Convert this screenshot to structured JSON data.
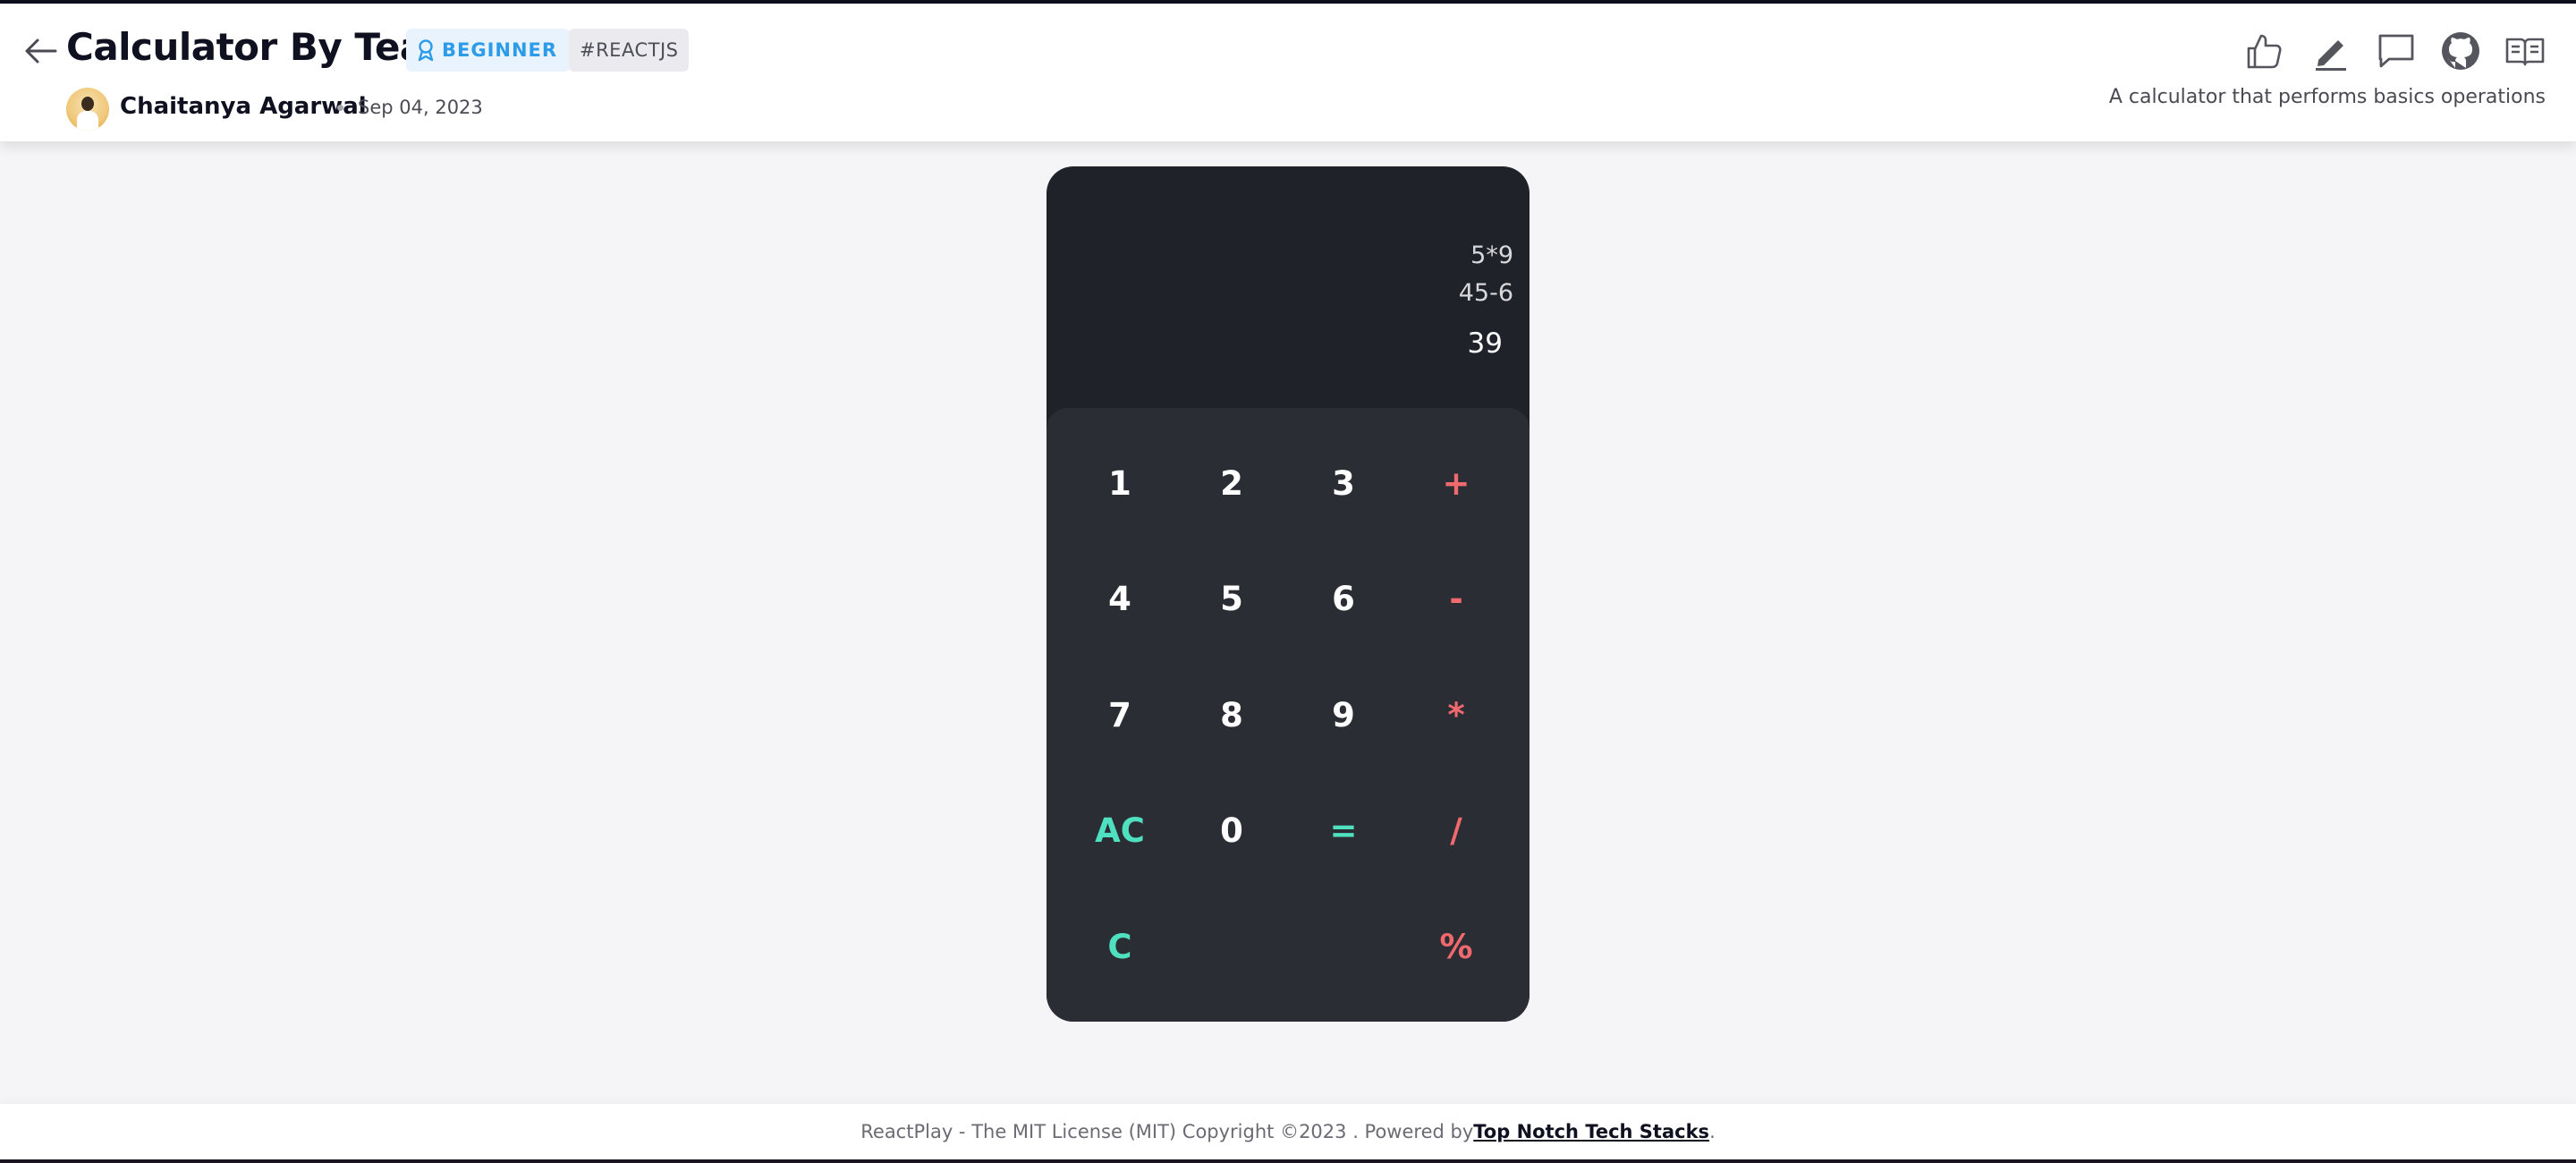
{
  "header": {
    "title": "Calculator By Tea",
    "level_badge": "BEGINNER",
    "tag": "#REACTJS",
    "author": "Chaitanya Agarwal",
    "date": "Sep 04, 2023",
    "description": "A calculator that performs basics operations",
    "action_icons": [
      "like-icon",
      "edit-icon",
      "comment-icon",
      "github-icon",
      "read-icon"
    ]
  },
  "calculator": {
    "history": [
      "5*9",
      "45-6"
    ],
    "result": "39",
    "keys": {
      "one": "1",
      "two": "2",
      "three": "3",
      "plus": "+",
      "four": "4",
      "five": "5",
      "six": "6",
      "minus": "-",
      "seven": "7",
      "eight": "8",
      "nine": "9",
      "multiply": "*",
      "all_clear": "AC",
      "zero": "0",
      "equals": "=",
      "divide": "/",
      "clear": "C",
      "percent": "%"
    },
    "colors": {
      "operator": "#f0696d",
      "function": "#4fe0c0",
      "digit": "#ffffff"
    }
  },
  "footer": {
    "text_before": "ReactPlay - The MIT License (MIT) Copyright ©2023 . Powered by ",
    "link": "Top Notch Tech Stacks",
    "text_after": "."
  }
}
